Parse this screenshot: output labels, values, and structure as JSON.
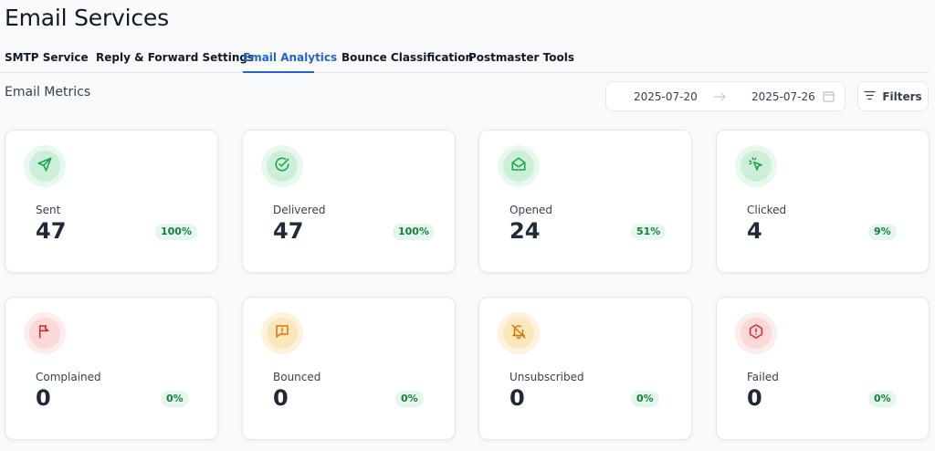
{
  "header": {
    "title": "Email Services"
  },
  "tabs": [
    {
      "label": "SMTP Service"
    },
    {
      "label": "Reply & Forward Settings"
    },
    {
      "label": "Email Analytics"
    },
    {
      "label": "Bounce Classification"
    },
    {
      "label": "Postmaster Tools"
    }
  ],
  "active_tab": "Email Analytics",
  "metrics": {
    "title": "Email Metrics",
    "date_start": "2025-07-20",
    "date_end": "2025-07-26",
    "filters_label": "Filters"
  },
  "cards": [
    {
      "label": "Sent",
      "value": "47",
      "percent": "100%",
      "icon": "send-icon",
      "tone": "green"
    },
    {
      "label": "Delivered",
      "value": "47",
      "percent": "100%",
      "icon": "check-circle-icon",
      "tone": "green"
    },
    {
      "label": "Opened",
      "value": "24",
      "percent": "51%",
      "icon": "mail-open-icon",
      "tone": "green"
    },
    {
      "label": "Clicked",
      "value": "4",
      "percent": "9%",
      "icon": "cursor-click-icon",
      "tone": "green"
    },
    {
      "label": "Complained",
      "value": "0",
      "percent": "0%",
      "icon": "flag-icon",
      "tone": "red"
    },
    {
      "label": "Bounced",
      "value": "0",
      "percent": "0%",
      "icon": "message-alert-icon",
      "tone": "amber"
    },
    {
      "label": "Unsubscribed",
      "value": "0",
      "percent": "0%",
      "icon": "bell-off-icon",
      "tone": "amber"
    },
    {
      "label": "Failed",
      "value": "0",
      "percent": "0%",
      "icon": "octagon-alert-icon",
      "tone": "red"
    }
  ],
  "colors": {
    "accent": "#2563c9",
    "green_icon": "#16a34a",
    "red_icon": "#dc2626",
    "amber_icon": "#d97706",
    "badge_bg": "#e7f6ec",
    "badge_text": "#15803d"
  }
}
